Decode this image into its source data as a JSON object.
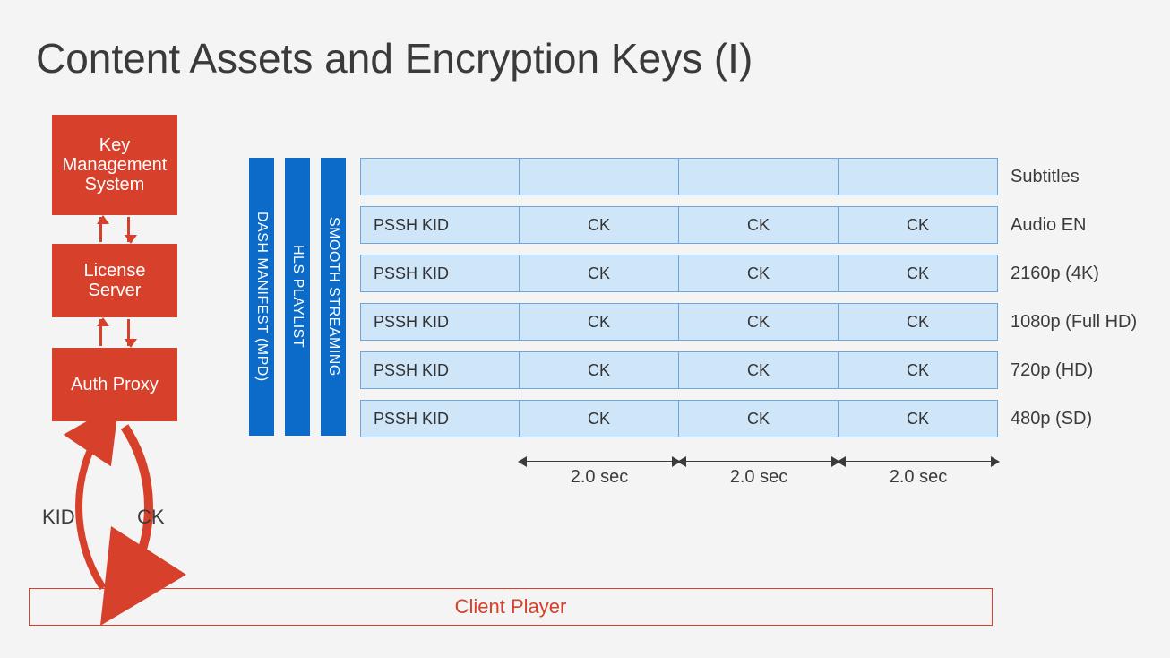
{
  "title": "Content Assets and Encryption Keys (I)",
  "left_stack": {
    "kms": "Key Management System",
    "license": "License Server",
    "auth": "Auth Proxy"
  },
  "arrow_labels": {
    "kid": "KID",
    "ck": "CK"
  },
  "client_player": "Client Player",
  "manifests": {
    "dash": "DASH MANIFEST (MPD)",
    "hls": "HLS PLAYLIST",
    "smooth": "SMOOTH STREAMING"
  },
  "cells": {
    "first": "PSSH KID",
    "chunk": "CK"
  },
  "tracks": [
    {
      "label": "Subtitles",
      "encrypted": false
    },
    {
      "label": "Audio EN",
      "encrypted": true
    },
    {
      "label": "2160p (4K)",
      "encrypted": true
    },
    {
      "label": "1080p (Full HD)",
      "encrypted": true
    },
    {
      "label": "720p (HD)",
      "encrypted": true
    },
    {
      "label": "480p (SD)",
      "encrypted": true
    }
  ],
  "segment_duration": "2.0 sec"
}
